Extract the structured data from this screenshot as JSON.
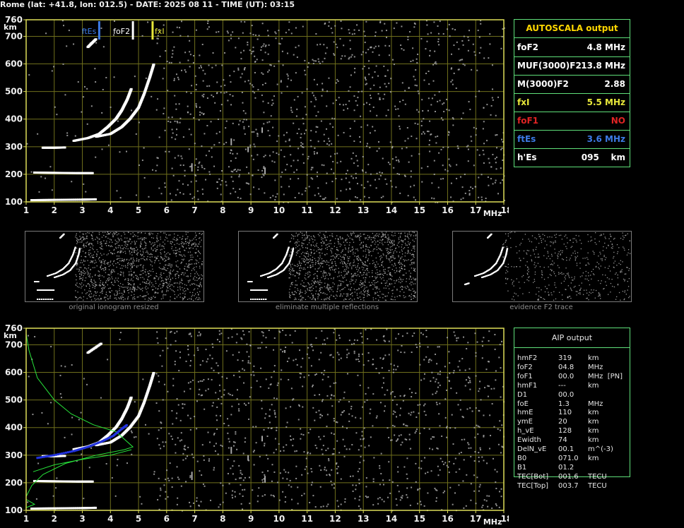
{
  "header": "Rome (lat: +41.8, lon: 012.5) - DATE: 2025 08 11 - TIME (UT): 03:15",
  "colors": {
    "frame": "#dede58",
    "grid": "#6f6f1c",
    "tick": "#dede58",
    "trace": "#ffffff",
    "noise": "#a8a8a8",
    "fxEs": "#3d7be6",
    "foF2": "#ffffff",
    "fxI": "#e8e83a",
    "foF1": "#e02424",
    "green": "#27e43a",
    "blue": "#2233dd",
    "panel_border": "#5fe07a"
  },
  "axes": {
    "y_unit": "km",
    "x_unit": "MHz",
    "x_ticks": [
      "1",
      "2",
      "3",
      "4",
      "5",
      "6",
      "7",
      "8",
      "9",
      "10",
      "11",
      "12",
      "13",
      "14",
      "15",
      "16",
      "17",
      "18"
    ],
    "y_ticks": [
      "100",
      "200",
      "300",
      "400",
      "500",
      "600",
      "700",
      "760"
    ]
  },
  "markers": {
    "fxEs_label": "ftEs",
    "foF2_label": "foF2",
    "fxI_label": "fxI"
  },
  "autoscala": {
    "title": "AUTOSCALA output",
    "rows": [
      {
        "label": "foF2",
        "value": "4.8 MHz",
        "color": "#ffffff"
      },
      {
        "label": "MUF(3000)F2",
        "value": "13.8 MHz",
        "color": "#ffffff"
      },
      {
        "label": "M(3000)F2",
        "value": "2.88",
        "color": "#ffffff"
      },
      {
        "label": "fxI",
        "value": "5.5 MHz",
        "color": "#e8e83a"
      },
      {
        "label": "foF1",
        "value": "NO",
        "color": "#e02424"
      },
      {
        "label": "ftEs",
        "value": "3.6 MHz",
        "color": "#3d7be6"
      },
      {
        "label": "h'Es",
        "value": "095    km",
        "color": "#ffffff"
      }
    ]
  },
  "thumbnails": [
    {
      "caption": "original ionogram resized"
    },
    {
      "caption": "eliminate multiple reflections"
    },
    {
      "caption": "evidence F2 trace"
    }
  ],
  "aip": {
    "title": "AIP output",
    "rows": [
      {
        "name": "hmF2",
        "value": "319",
        "unit": "km"
      },
      {
        "name": "foF2",
        "value": "04.8",
        "unit": "MHz"
      },
      {
        "name": "foF1",
        "value": "00.0",
        "unit": "MHz  [PN]"
      },
      {
        "name": "hmF1",
        "value": "---",
        "unit": "km"
      },
      {
        "name": "D1",
        "value": "00.0",
        "unit": ""
      },
      {
        "name": "foE",
        "value": "1.3",
        "unit": "MHz"
      },
      {
        "name": "hmE",
        "value": "110",
        "unit": "km"
      },
      {
        "name": "ymE",
        "value": "20",
        "unit": "km"
      },
      {
        "name": "h_vE",
        "value": "128",
        "unit": "km"
      },
      {
        "name": "Ewidth",
        "value": "74",
        "unit": "km"
      },
      {
        "name": "DelN_vE",
        "value": "00.1",
        "unit": "m^(-3)"
      },
      {
        "name": "B0",
        "value": "071.0",
        "unit": "km"
      },
      {
        "name": "B1",
        "value": "01.2",
        "unit": ""
      },
      {
        "name": "TEC[Bot]",
        "value": "001.6",
        "unit": "TECU"
      },
      {
        "name": "TEC[Top]",
        "value": "003.7",
        "unit": "TECU"
      }
    ]
  },
  "chart_data": [
    {
      "type": "scatter",
      "name": "ionogram-autoscala",
      "xlim": [
        1,
        18
      ],
      "ylim": [
        100,
        760
      ],
      "xlabel": "MHz",
      "ylabel": "km",
      "grid": true,
      "series": [
        {
          "values": [
            [
              1.6,
              295
            ],
            [
              2.0,
              295
            ],
            [
              2.4,
              296
            ]
          ]
        },
        {
          "values": [
            [
              1.3,
              205
            ],
            [
              2.0,
              204
            ],
            [
              2.8,
              203
            ],
            [
              3.4,
              203
            ]
          ]
        },
        {
          "values": [
            [
              1.2,
              105
            ],
            [
              2.0,
              106
            ],
            [
              3.0,
              107
            ],
            [
              3.5,
              108
            ]
          ]
        },
        {
          "values": [
            [
              2.7,
              320
            ],
            [
              3.2,
              330
            ],
            [
              3.6,
              345
            ],
            [
              3.9,
              370
            ],
            [
              4.2,
              400
            ],
            [
              4.4,
              430
            ],
            [
              4.6,
              470
            ],
            [
              4.75,
              510
            ]
          ]
        },
        {
          "values": [
            [
              3.5,
              335
            ],
            [
              4.0,
              345
            ],
            [
              4.4,
              370
            ],
            [
              4.7,
              400
            ],
            [
              5.0,
              440
            ],
            [
              5.2,
              490
            ],
            [
              5.4,
              550
            ],
            [
              5.55,
              600
            ]
          ]
        },
        {
          "values": [
            [
              3.2,
              660
            ],
            [
              3.5,
              690
            ]
          ]
        }
      ],
      "markers": [
        {
          "label": "ftEs",
          "x": 3.6
        },
        {
          "label": "foF2",
          "x": 4.8
        },
        {
          "label": "fxI",
          "x": 5.5
        }
      ]
    },
    {
      "type": "scatter",
      "name": "ionogram-aip",
      "xlim": [
        1,
        18
      ],
      "ylim": [
        100,
        760
      ],
      "xlabel": "MHz",
      "ylabel": "km",
      "grid": true,
      "series": [
        {
          "values": [
            [
              1.6,
              295
            ],
            [
              2.0,
              295
            ],
            [
              2.4,
              296
            ]
          ]
        },
        {
          "values": [
            [
              1.3,
              205
            ],
            [
              2.0,
              204
            ],
            [
              2.8,
              203
            ],
            [
              3.4,
              203
            ]
          ]
        },
        {
          "values": [
            [
              1.2,
              105
            ],
            [
              2.0,
              106
            ],
            [
              3.0,
              107
            ],
            [
              3.5,
              108
            ]
          ]
        },
        {
          "values": [
            [
              2.7,
              320
            ],
            [
              3.2,
              330
            ],
            [
              3.6,
              345
            ],
            [
              3.9,
              370
            ],
            [
              4.2,
              400
            ],
            [
              4.4,
              430
            ],
            [
              4.6,
              470
            ],
            [
              4.75,
              510
            ]
          ]
        },
        {
          "values": [
            [
              3.5,
              335
            ],
            [
              4.0,
              345
            ],
            [
              4.4,
              370
            ],
            [
              4.7,
              400
            ],
            [
              5.0,
              440
            ],
            [
              5.2,
              490
            ],
            [
              5.4,
              550
            ],
            [
              5.55,
              600
            ]
          ]
        },
        {
          "values": [
            [
              3.2,
              670
            ],
            [
              3.7,
              705
            ]
          ]
        }
      ],
      "profile_curve": [
        [
          1.0,
          740
        ],
        [
          1.1,
          680
        ],
        [
          1.4,
          580
        ],
        [
          2.0,
          500
        ],
        [
          2.6,
          450
        ],
        [
          3.4,
          410
        ],
        [
          4.2,
          385
        ],
        [
          4.8,
          330
        ],
        [
          4.5,
          320
        ],
        [
          3.5,
          300
        ],
        [
          2.4,
          270
        ],
        [
          1.6,
          230
        ],
        [
          1.2,
          190
        ],
        [
          1.0,
          150
        ],
        [
          1.0,
          140
        ],
        [
          1.3,
          122
        ],
        [
          1.0,
          110
        ]
      ],
      "profile_curve2": [
        [
          1.25,
          240
        ],
        [
          2.0,
          265
        ],
        [
          3.0,
          285
        ],
        [
          4.0,
          300
        ],
        [
          4.75,
          320
        ]
      ],
      "blue_trace": [
        [
          1.4,
          290
        ],
        [
          2.0,
          300
        ],
        [
          2.7,
          315
        ],
        [
          3.2,
          330
        ],
        [
          3.7,
          350
        ],
        [
          4.1,
          370
        ],
        [
          4.4,
          395
        ],
        [
          4.6,
          410
        ]
      ]
    }
  ]
}
